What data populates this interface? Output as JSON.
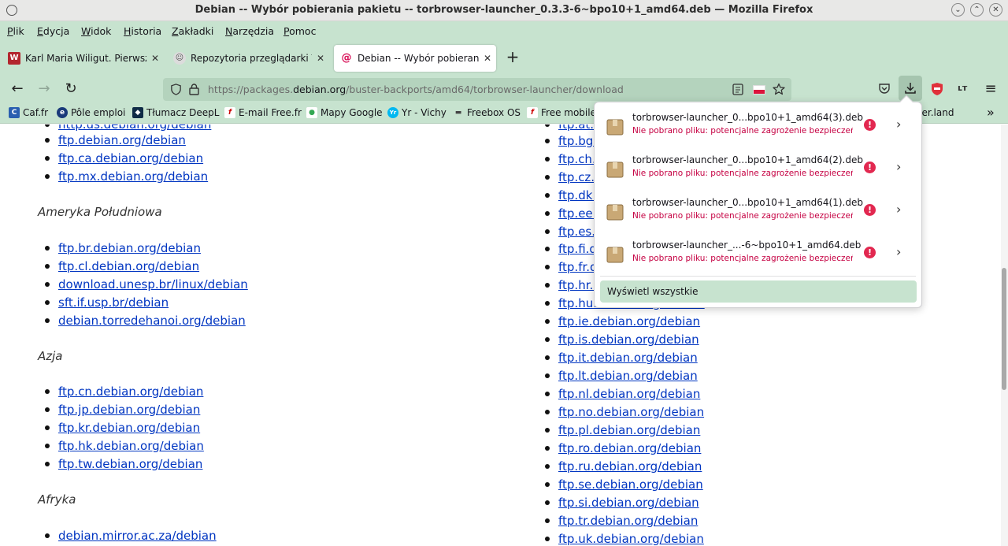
{
  "window": {
    "title": "Debian -- Wybór pobierania pakietu -- torbrowser-launcher_0.3.3-6~bpo10+1_amd64.deb — Mozilla Firefox",
    "min": "⌄",
    "max": "⌃",
    "close": "✕"
  },
  "menu": [
    "Plik",
    "Edycja",
    "Widok",
    "Historia",
    "Zakładki",
    "Narzędzia",
    "Pomoc"
  ],
  "tabs": [
    {
      "title": "Karl Maria Wiligut. Pierwszy",
      "favicon": "W",
      "close": "✕"
    },
    {
      "title": "Repozytoria przeglądarki TO",
      "favicon": "☺",
      "close": "✕"
    },
    {
      "title": "Debian -- Wybór pobierania",
      "favicon": "@",
      "close": "✕"
    }
  ],
  "newtab": "+",
  "nav": {
    "back": "←",
    "forward": "→",
    "reload": "↻",
    "url_prefix": "https://packages.",
    "url_domain": "debian.org",
    "url_suffix": "/buster-backports/amd64/torbrowser-launcher/download",
    "menu": "≡"
  },
  "bookmarks": [
    {
      "label": "Caf.fr",
      "icon": "C",
      "color": "#2a5fb0"
    },
    {
      "label": "Pôle emploi",
      "icon": "e",
      "color": "#1a3a7a"
    },
    {
      "label": "Tłumacz DeepL",
      "icon": "◆",
      "color": "#0f2b46"
    },
    {
      "label": "E-mail Free.fr",
      "icon": "f",
      "color": "#cc0000"
    },
    {
      "label": "Mapy Google",
      "icon": "●",
      "color": "#34a853"
    },
    {
      "label": "Yr - Vichy",
      "icon": "Yr",
      "color": "#00b8f1"
    },
    {
      "label": "Freebox OS",
      "icon": "▬",
      "color": "#444444"
    },
    {
      "label": "Free mobile",
      "icon": "f",
      "color": "#cc0000"
    },
    {
      "label": "ker.land",
      "icon": "",
      "color": "#c7e3cf"
    }
  ],
  "bookmarks_overflow": "»",
  "content": {
    "left": {
      "partial_top": "http.us.debian.org/debian",
      "top_list": [
        "ftp.debian.org/debian",
        "ftp.ca.debian.org/debian",
        "ftp.mx.debian.org/debian"
      ],
      "sections": [
        {
          "heading": "Ameryka Południowa",
          "items": [
            "ftp.br.debian.org/debian",
            "ftp.cl.debian.org/debian",
            "download.unesp.br/linux/debian",
            "sft.if.usp.br/debian",
            "debian.torredehanoi.org/debian"
          ]
        },
        {
          "heading": "Azja",
          "items": [
            "ftp.cn.debian.org/debian",
            "ftp.jp.debian.org/debian",
            "ftp.kr.debian.org/debian",
            "ftp.hk.debian.org/debian",
            "ftp.tw.debian.org/debian"
          ]
        },
        {
          "heading": "Afryka",
          "items": [
            "debian.mirror.ac.za/debian"
          ]
        }
      ]
    },
    "right": {
      "partial_top": "ftp.at.debian.org/debian",
      "items": [
        "ftp.bg.debian.org/debian",
        "ftp.ch.debian.org/debian",
        "ftp.cz.debian.org/debian",
        "ftp.dk.debian.org/debian",
        "ftp.ee.debian.org/debian",
        "ftp.es.debian.org/debian",
        "ftp.fi.debian.org/debian",
        "ftp.fr.debian.org/debian",
        "ftp.hr.debian.org/debian",
        "ftp.hu.debian.org/debian",
        "ftp.ie.debian.org/debian",
        "ftp.is.debian.org/debian",
        "ftp.it.debian.org/debian",
        "ftp.lt.debian.org/debian",
        "ftp.nl.debian.org/debian",
        "ftp.no.debian.org/debian",
        "ftp.pl.debian.org/debian",
        "ftp.ro.debian.org/debian",
        "ftp.ru.debian.org/debian",
        "ftp.se.debian.org/debian",
        "ftp.si.debian.org/debian",
        "ftp.tr.debian.org/debian",
        "ftp.uk.debian.org/debian"
      ]
    }
  },
  "downloads": {
    "items": [
      {
        "name": "torbrowser-launcher_0...bpo10+1_amd64(3).deb",
        "status": "Nie pobrano pliku: potencjalne zagrożenie bezpieczeństwa."
      },
      {
        "name": "torbrowser-launcher_0...bpo10+1_amd64(2).deb",
        "status": "Nie pobrano pliku: potencjalne zagrożenie bezpieczeństwa."
      },
      {
        "name": "torbrowser-launcher_0...bpo10+1_amd64(1).deb",
        "status": "Nie pobrano pliku: potencjalne zagrożenie bezpieczeństwa."
      },
      {
        "name": "torbrowser-launcher_...-6~bpo10+1_amd64.deb",
        "status": "Nie pobrano pliku: potencjalne zagrożenie bezpieczeństwa."
      }
    ],
    "warn_glyph": "!",
    "more_glyph": "›",
    "show_all": "Wyświetl wszystkie"
  }
}
